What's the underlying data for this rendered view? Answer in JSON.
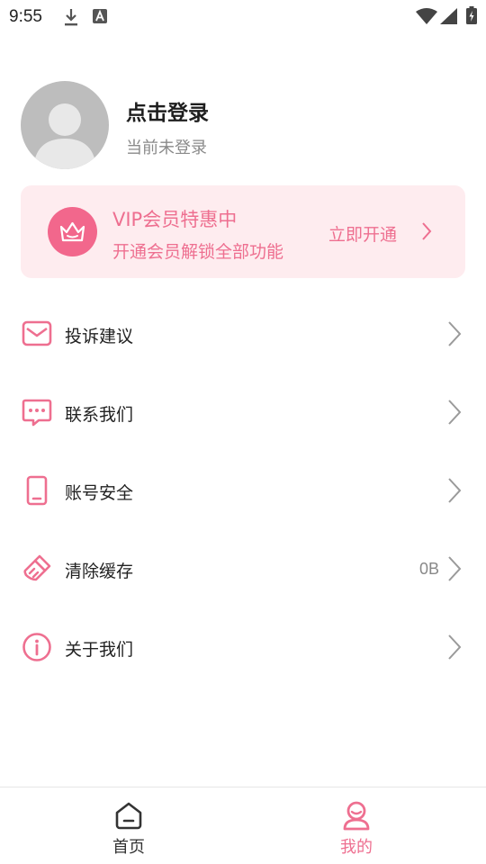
{
  "status_bar": {
    "time": "9:55"
  },
  "profile": {
    "title": "点击登录",
    "subtitle": "当前未登录"
  },
  "vip": {
    "title": "VIP会员特惠中",
    "subtitle": "开通会员解锁全部功能",
    "action": "立即开通",
    "accent": "#f2678c",
    "background": "#feecef"
  },
  "menu": {
    "items": [
      {
        "label": "投诉建议",
        "icon": "mail-icon",
        "value": ""
      },
      {
        "label": "联系我们",
        "icon": "chat-icon",
        "value": ""
      },
      {
        "label": "账号安全",
        "icon": "phone-icon",
        "value": ""
      },
      {
        "label": "清除缓存",
        "icon": "broom-icon",
        "value": "0B"
      },
      {
        "label": "关于我们",
        "icon": "info-icon",
        "value": ""
      }
    ]
  },
  "tabbar": {
    "tabs": [
      {
        "label": "首页",
        "icon": "home-icon",
        "active": false
      },
      {
        "label": "我的",
        "icon": "profile-icon",
        "active": true
      }
    ],
    "active_color": "#ee6f90",
    "inactive_color": "#333333"
  }
}
